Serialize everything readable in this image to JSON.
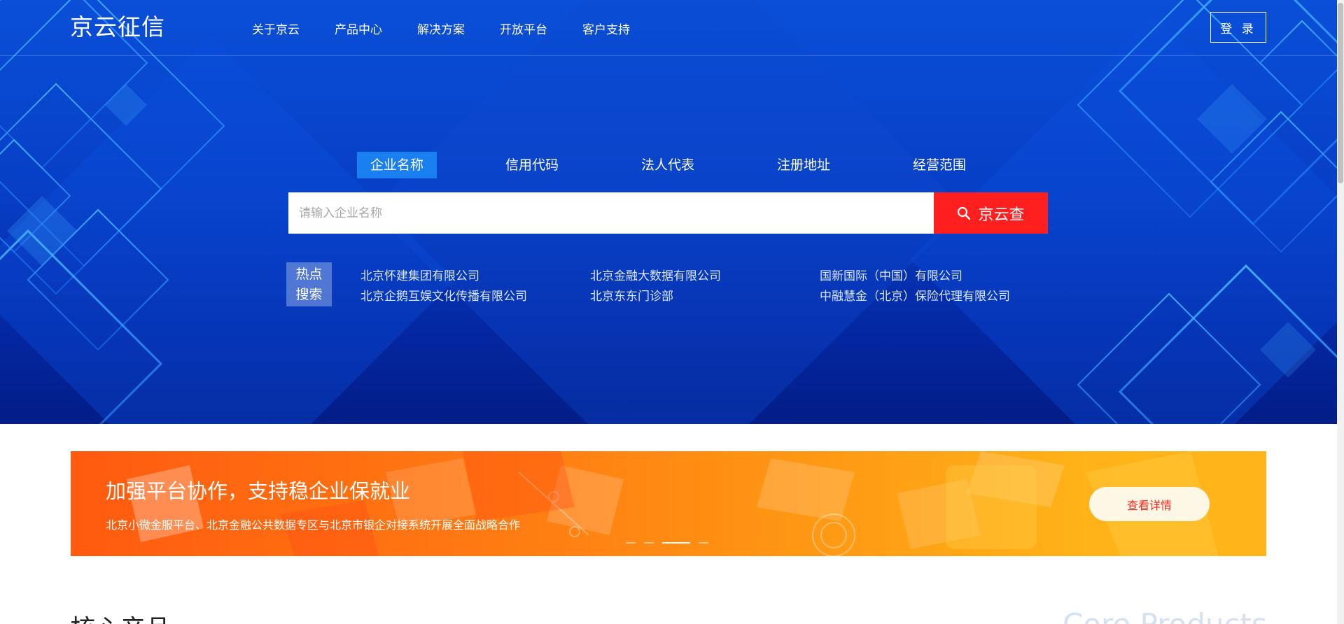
{
  "brand": {
    "logo_text": "京云征信"
  },
  "nav": {
    "items": [
      {
        "label": "关于京云"
      },
      {
        "label": "产品中心"
      },
      {
        "label": "解决方案"
      },
      {
        "label": "开放平台"
      },
      {
        "label": "客户支持"
      }
    ],
    "login_label": "登 录"
  },
  "search": {
    "tabs": [
      {
        "label": "企业名称",
        "active": true
      },
      {
        "label": "信用代码",
        "active": false
      },
      {
        "label": "法人代表",
        "active": false
      },
      {
        "label": "注册地址",
        "active": false
      },
      {
        "label": "经营范围",
        "active": false
      }
    ],
    "placeholder": "请输入企业名称",
    "value": "",
    "button_label": "京云查",
    "button_icon": "search-icon"
  },
  "hot_search": {
    "badge_line1": "热点",
    "badge_line2": "搜索",
    "links": [
      "北京怀建集团有限公司",
      "北京金融大数据有限公司",
      "国新国际（中国）有限公司",
      "北京企鹅互娱文化传播有限公司",
      "北京东东门诊部",
      "中融慧金（北京）保险代理有限公司"
    ]
  },
  "banner": {
    "title": "加强平台协作，支持稳企业保就业",
    "subtitle": "北京小微金服平台、北京金融公共数据专区与北京市银企对接系统开展全面战略合作",
    "button_label": "查看详情",
    "slide_count": 4,
    "active_slide": 3
  },
  "core_section": {
    "title": "核心产品",
    "title_en": "Core Products"
  },
  "colors": {
    "hero_blue": "#0a4fd8",
    "active_tab": "#1a7ff0",
    "search_button": "#ff1f1f",
    "banner_orange": "#ff7a12",
    "banner_button_text": "#f0281e"
  }
}
